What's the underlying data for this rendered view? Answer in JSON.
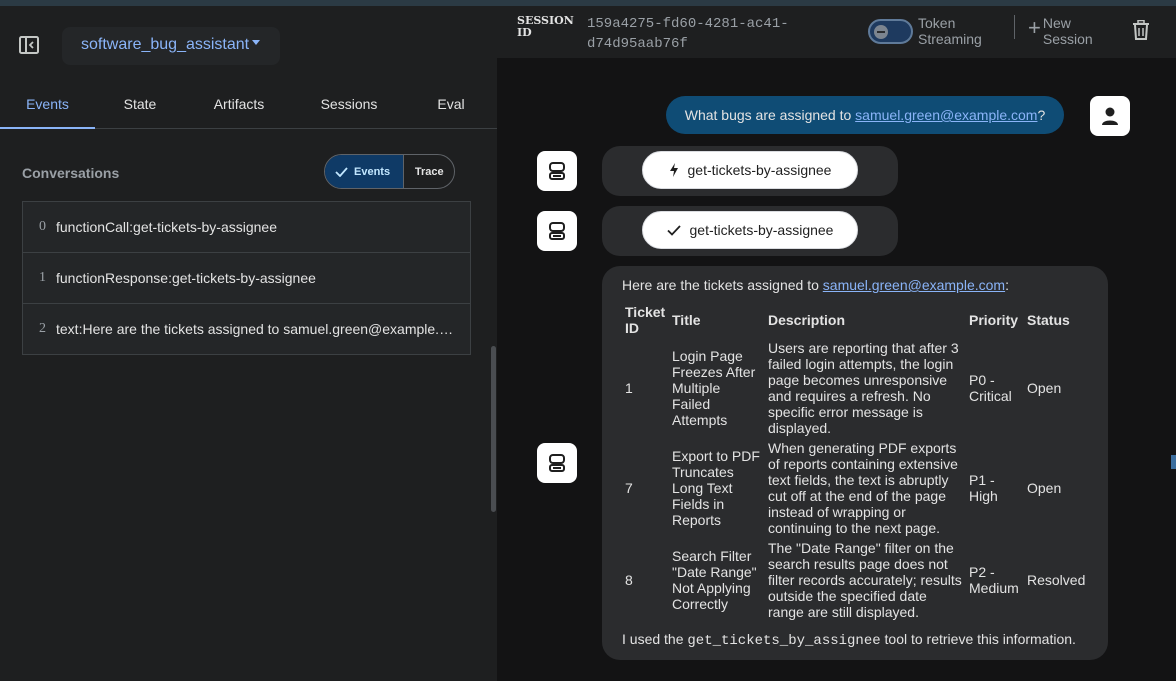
{
  "app": {
    "selected_app": "software_bug_assistant"
  },
  "tabs": [
    "Events",
    "State",
    "Artifacts",
    "Sessions",
    "Eval"
  ],
  "conversations": {
    "label": "Conversations",
    "toggle": {
      "events": "Events",
      "trace": "Trace"
    },
    "events": [
      {
        "index": "0",
        "text": "functionCall:get-tickets-by-assignee"
      },
      {
        "index": "1",
        "text": "functionResponse:get-tickets-by-assignee"
      },
      {
        "index": "2",
        "text": "text:Here are the tickets assigned to samuel.green@example.com:"
      }
    ]
  },
  "header": {
    "session_label": "SESSION ID",
    "session_id": "159a4275-fd60-4281-ac41-d74d95aab76f",
    "token_streaming": "Token Streaming",
    "new_session": "New Session"
  },
  "chat": {
    "user_message_prefix": "What bugs are assigned to ",
    "user_message_email": "samuel.green@example.com",
    "user_message_suffix": "?",
    "function_call_chip": "get-tickets-by-assignee",
    "function_response_chip": "get-tickets-by-assignee",
    "response": {
      "intro_prefix": "Here are the tickets assigned to ",
      "intro_email": "samuel.green@example.com",
      "intro_suffix": ":",
      "table_headers": [
        "Ticket ID",
        "Title",
        "Description",
        "Priority",
        "Status"
      ],
      "rows": [
        {
          "id": "1",
          "title": "Login Page Freezes After Multiple Failed Attempts",
          "description": "Users are reporting that after 3 failed login attempts, the login page becomes unresponsive and requires a refresh. No specific error message is displayed.",
          "priority": "P0 - Critical",
          "status": "Open"
        },
        {
          "id": "7",
          "title": "Export to PDF Truncates Long Text Fields in Reports",
          "description": "When generating PDF exports of reports containing extensive text fields, the text is abruptly cut off at the end of the page instead of wrapping or continuing to the next page.",
          "priority": "P1 - High",
          "status": "Open"
        },
        {
          "id": "8",
          "title": "Search Filter \"Date Range\" Not Applying Correctly",
          "description": "The \"Date Range\" filter on the search results page does not filter records accurately; results outside the specified date range are still displayed.",
          "priority": "P2 - Medium",
          "status": "Resolved"
        }
      ],
      "outro_prefix": "I used the ",
      "outro_code": "get_tickets_by_assignee",
      "outro_suffix": " tool to retrieve this information."
    }
  },
  "colors": {
    "accent": "#8ab4f8",
    "user_bubble": "#0f4c75",
    "bot_bubble": "#2b2c2e",
    "panel": "#1e1f20"
  }
}
